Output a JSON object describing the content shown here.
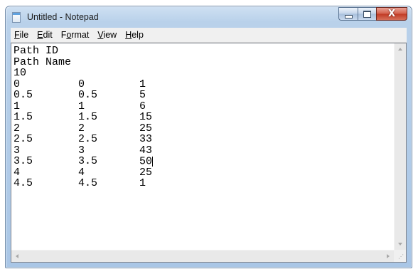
{
  "window": {
    "title": "Untitled - Notepad",
    "icons": {
      "app": "notepad-icon",
      "minimize": "minimize-icon",
      "maximize": "maximize-icon",
      "close": "close-icon",
      "close_glyph": "X"
    }
  },
  "menu": {
    "items": [
      {
        "label_ul": "F",
        "label_rest": "ile"
      },
      {
        "label_ul": "E",
        "label_rest": "dit"
      },
      {
        "label_pre": "F",
        "label_ul": "o",
        "label_rest": "rmat"
      },
      {
        "label_ul": "V",
        "label_rest": "iew"
      },
      {
        "label_ul": "H",
        "label_rest": "elp"
      }
    ]
  },
  "document": {
    "header": [
      "Path ID",
      "Path Name",
      "10"
    ],
    "rows": [
      [
        "0",
        "0",
        "1"
      ],
      [
        "0.5",
        "0.5",
        "5"
      ],
      [
        "1",
        "1",
        "6"
      ],
      [
        "1.5",
        "1.5",
        "15"
      ],
      [
        "2",
        "2",
        "25"
      ],
      [
        "2.5",
        "2.5",
        "33"
      ],
      [
        "3",
        "3",
        "43"
      ],
      [
        "3.5",
        "3.5",
        "50"
      ],
      [
        "4",
        "4",
        "25"
      ],
      [
        "4.5",
        "4.5",
        "1"
      ]
    ]
  },
  "colors": {
    "titlebar": "#b9d1ea",
    "close_button": "#c13a24"
  }
}
